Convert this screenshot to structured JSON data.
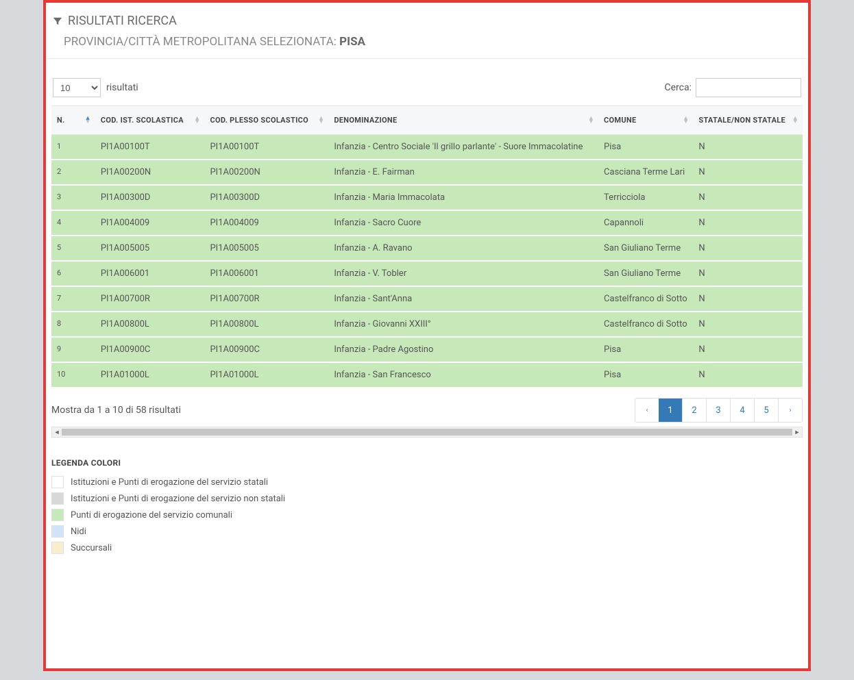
{
  "header": {
    "title": "RISULTATI RICERCA",
    "subtitle_prefix": "PROVINCIA/CITTÀ METROPOLITANA SELEZIONATA: ",
    "subtitle_value": "PISA"
  },
  "controls": {
    "page_length_value": "10",
    "page_length_suffix": "risultati",
    "search_label": "Cerca:",
    "search_value": ""
  },
  "columns": {
    "n": "N.",
    "cod_ist": "COD. IST. SCOLASTICA",
    "cod_plesso": "COD. PLESSO SCOLASTICO",
    "denominazione": "DENOMINAZIONE",
    "comune": "COMUNE",
    "statale": "STATALE/NON STATALE"
  },
  "rows": [
    {
      "n": "1",
      "cod_ist": "PI1A00100T",
      "cod_plesso": "PI1A00100T",
      "denom": "Infanzia - Centro Sociale 'Il grillo parlante' - Suore Immacolatine",
      "comune": "Pisa",
      "statale": "N"
    },
    {
      "n": "2",
      "cod_ist": "PI1A00200N",
      "cod_plesso": "PI1A00200N",
      "denom": "Infanzia - E. Fairman",
      "comune": "Casciana Terme Lari",
      "statale": "N"
    },
    {
      "n": "3",
      "cod_ist": "PI1A00300D",
      "cod_plesso": "PI1A00300D",
      "denom": "Infanzia - Maria Immacolata",
      "comune": "Terricciola",
      "statale": "N"
    },
    {
      "n": "4",
      "cod_ist": "PI1A004009",
      "cod_plesso": "PI1A004009",
      "denom": "Infanzia - Sacro Cuore",
      "comune": "Capannoli",
      "statale": "N"
    },
    {
      "n": "5",
      "cod_ist": "PI1A005005",
      "cod_plesso": "PI1A005005",
      "denom": "Infanzia - A. Ravano",
      "comune": "San Giuliano Terme",
      "statale": "N"
    },
    {
      "n": "6",
      "cod_ist": "PI1A006001",
      "cod_plesso": "PI1A006001",
      "denom": "Infanzia - V. Tobler",
      "comune": "San Giuliano Terme",
      "statale": "N"
    },
    {
      "n": "7",
      "cod_ist": "PI1A00700R",
      "cod_plesso": "PI1A00700R",
      "denom": "Infanzia - Sant'Anna",
      "comune": "Castelfranco di Sotto",
      "statale": "N"
    },
    {
      "n": "8",
      "cod_ist": "PI1A00800L",
      "cod_plesso": "PI1A00800L",
      "denom": "Infanzia - Giovanni XXIII°",
      "comune": "Castelfranco di Sotto",
      "statale": "N"
    },
    {
      "n": "9",
      "cod_ist": "PI1A00900C",
      "cod_plesso": "PI1A00900C",
      "denom": "Infanzia - Padre Agostino",
      "comune": "Pisa",
      "statale": "N"
    },
    {
      "n": "10",
      "cod_ist": "PI1A01000L",
      "cod_plesso": "PI1A01000L",
      "denom": "Infanzia - San Francesco",
      "comune": "Pisa",
      "statale": "N"
    }
  ],
  "info_text": "Mostra da 1 a 10 di 58 risultati",
  "pagination": {
    "prev": "‹",
    "next": "›",
    "pages": [
      "1",
      "2",
      "3",
      "4",
      "5"
    ],
    "active": "1"
  },
  "legend": {
    "title": "LEGENDA COLORI",
    "items": [
      {
        "swatch": "sw-white",
        "label": "Istituzioni e Punti di erogazione del servizio statali"
      },
      {
        "swatch": "sw-grey",
        "label": "Istituzioni e Punti di erogazione del servizio non statali"
      },
      {
        "swatch": "sw-green",
        "label": "Punti di erogazione del servizio comunali"
      },
      {
        "swatch": "sw-blue",
        "label": "Nidi"
      },
      {
        "swatch": "sw-cream",
        "label": "Succursali"
      }
    ]
  }
}
